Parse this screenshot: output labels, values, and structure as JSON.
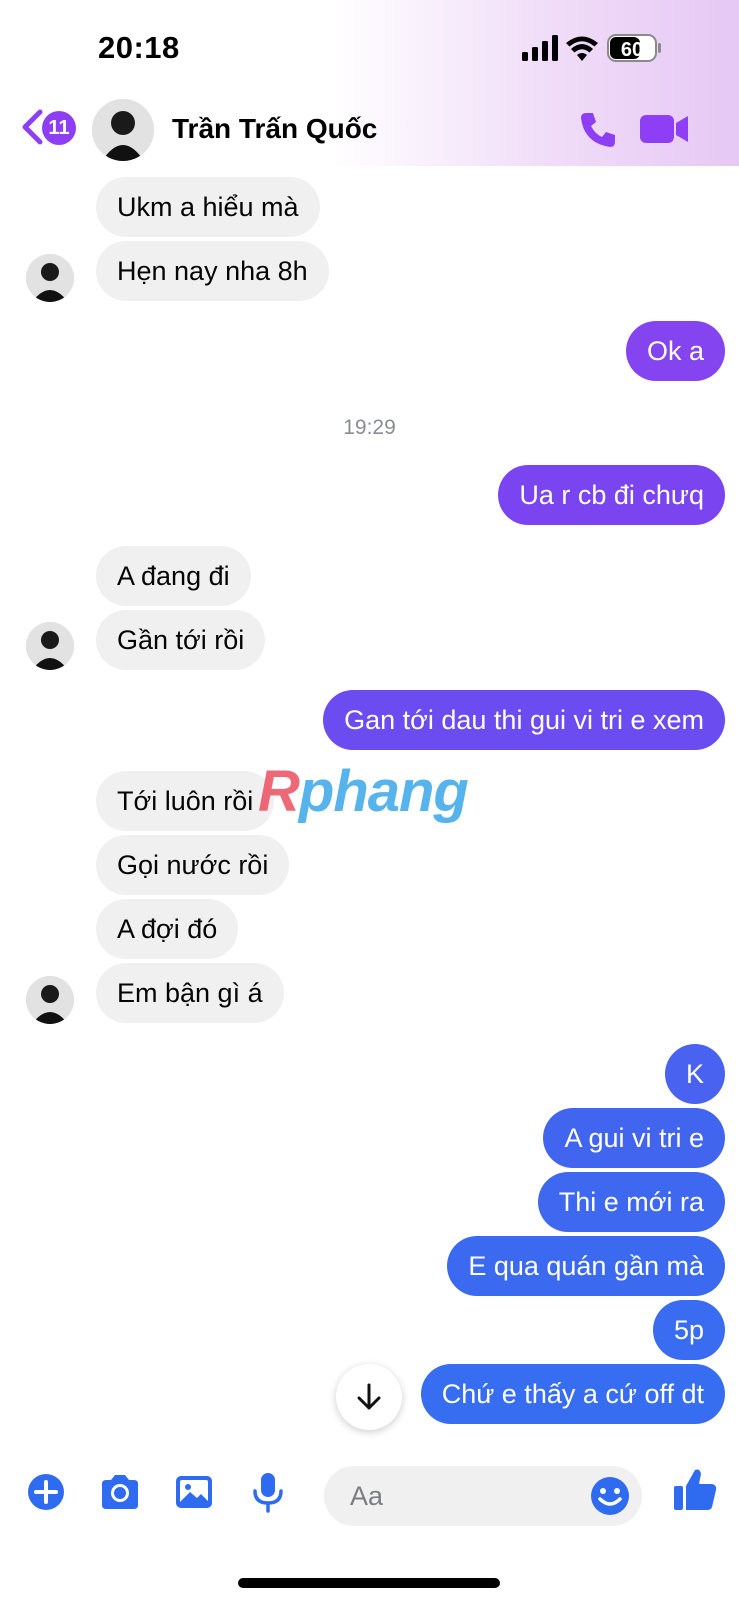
{
  "status_bar": {
    "time": "20:18",
    "battery": "60"
  },
  "header": {
    "back_badge": "11",
    "contact_name": "Trần Trấn Quốc"
  },
  "colors": {
    "accent": "#8e3ff5",
    "outgoing_purple": "#7b44f0",
    "outgoing_blue": "#3a6df0",
    "incoming": "#f0f0f0"
  },
  "messages": [
    {
      "dir": "in",
      "text": "Ukm a hiểu mà"
    },
    {
      "dir": "in",
      "text": "Hẹn nay nha 8h"
    },
    {
      "dir": "out",
      "text": "Ok a"
    },
    {
      "dir": "out",
      "text": "Ua r cb đi chưq"
    },
    {
      "dir": "in",
      "text": "A đang đi"
    },
    {
      "dir": "in",
      "text": "Gần tới rồi"
    },
    {
      "dir": "out",
      "text": "Gan tới dau thi gui vi tri e xem"
    },
    {
      "dir": "in",
      "text": "Tới luôn rồi"
    },
    {
      "dir": "in",
      "text": "Gọi nước rồi"
    },
    {
      "dir": "in",
      "text": "A đợi đó"
    },
    {
      "dir": "in",
      "text": "Em bận gì á"
    },
    {
      "dir": "out",
      "text": "K"
    },
    {
      "dir": "out",
      "text": "A gui vi tri e"
    },
    {
      "dir": "out",
      "text": "Thi e mới ra"
    },
    {
      "dir": "out",
      "text": "E qua quán gần mà"
    },
    {
      "dir": "out",
      "text": "5p"
    },
    {
      "dir": "out",
      "text": "Chứ e thấy a cứ off dt"
    }
  ],
  "timestamp": "19:29",
  "watermark": {
    "first": "R",
    "rest": "phang"
  },
  "composer": {
    "placeholder": "Aa"
  },
  "icons": [
    "add-icon",
    "camera-icon",
    "gallery-icon",
    "microphone-icon",
    "emoji-icon",
    "thumbs-up-icon",
    "phone-icon",
    "video-icon",
    "arrow-down-icon"
  ]
}
